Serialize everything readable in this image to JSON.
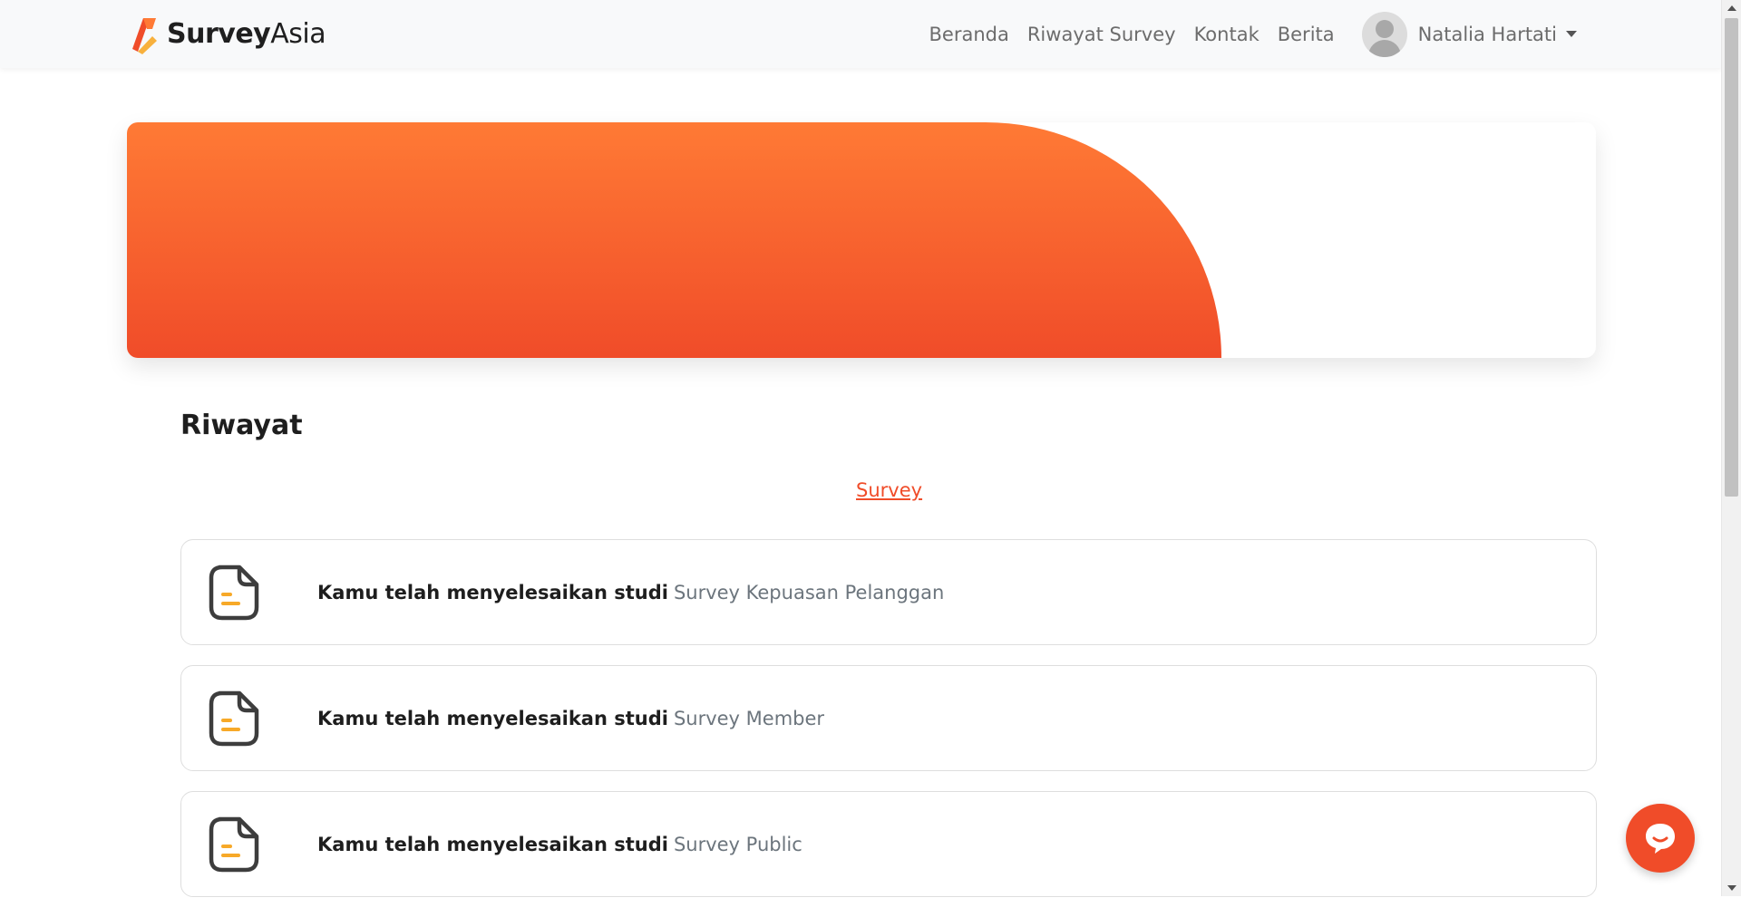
{
  "brand": {
    "name_bold": "Survey",
    "name_light": "Asia"
  },
  "nav": {
    "links": [
      "Beranda",
      "Riwayat Survey",
      "Kontak",
      "Berita"
    ],
    "user_name": "Natalia Hartati"
  },
  "main": {
    "heading": "Riwayat",
    "tab_label": "Survey",
    "items": [
      {
        "prefix": "Kamu telah menyelesaikan studi",
        "survey": "Survey Kepuasan Pelanggan"
      },
      {
        "prefix": "Kamu telah menyelesaikan studi",
        "survey": "Survey Member"
      },
      {
        "prefix": "Kamu telah menyelesaikan studi",
        "survey": "Survey Public"
      }
    ]
  },
  "colors": {
    "accent": "#f04c29",
    "accent_light": "#ff7a35",
    "icon_accent": "#f7a928"
  },
  "icons": {
    "logo": "logo-icon",
    "item": "document-icon",
    "chat": "chat-icon",
    "avatar": "user-avatar-icon"
  }
}
